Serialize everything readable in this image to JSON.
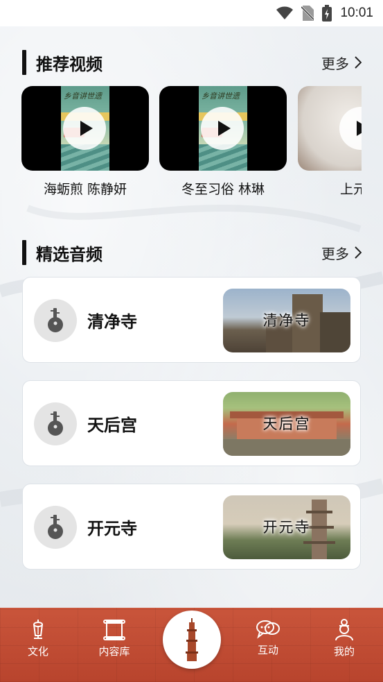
{
  "status_bar": {
    "time": "10:01",
    "icons": [
      "wifi-icon",
      "no-sim-icon",
      "battery-charging-icon"
    ]
  },
  "videos_section": {
    "title": "推荐视频",
    "more_label": "更多",
    "items": [
      {
        "title": "海蛎煎 陈静妍",
        "poster_text": "乡音讲世遗"
      },
      {
        "title": "冬至习俗 林琳",
        "poster_text": "乡音讲世遗"
      },
      {
        "title": "上元"
      }
    ]
  },
  "audio_section": {
    "title": "精选音频",
    "more_label": "更多",
    "items": [
      {
        "name": "清净寺",
        "thumb_label": "清净寺"
      },
      {
        "name": "天后宫",
        "thumb_label": "天后宫"
      },
      {
        "name": "开元寺",
        "thumb_label": "开元寺"
      }
    ]
  },
  "bottom_nav": {
    "items": [
      {
        "label": "文化",
        "icon": "lantern-icon"
      },
      {
        "label": "内容库",
        "icon": "scroll-icon"
      },
      {
        "label": "",
        "icon": "pagoda-icon"
      },
      {
        "label": "互动",
        "icon": "chat-bubbles-icon"
      },
      {
        "label": "我的",
        "icon": "profile-icon"
      }
    ]
  },
  "colors": {
    "nav_background": "#c14c34",
    "accent_black": "#111111",
    "card_background": "#ffffff"
  }
}
